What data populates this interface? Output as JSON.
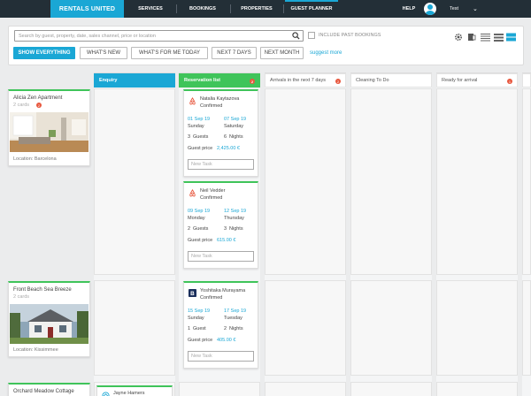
{
  "nav": {
    "brand": "RENTALS UNITED",
    "links": [
      "SERVICES",
      "BOOKINGS",
      "PROPERTIES",
      "GUEST PLANNER"
    ],
    "help": "HELP",
    "user": "Test",
    "active_color": "#1aa7d5"
  },
  "filters": {
    "search_placeholder": "Search by guest, property, date, sales channel, price or location",
    "include_past": "INCLUDE PAST BOOKINGS",
    "buttons": [
      "SHOW EVERYTHING",
      "WHAT'S NEW",
      "WHAT'S FOR ME TODAY",
      "NEXT 7 DAYS",
      "NEXT MONTH"
    ],
    "suggest_more": "suggest more",
    "icons": [
      "gear-icon",
      "export-icon",
      "list-view-icon",
      "compact-view-icon",
      "card-view-icon"
    ]
  },
  "columns": [
    {
      "title": "Enquiry",
      "badge": ""
    },
    {
      "title": "Reservation list",
      "badge": "2"
    },
    {
      "title": "Arrivals in the next 7 days",
      "badge": "2"
    },
    {
      "title": "Cleaning To Do",
      "badge": ""
    },
    {
      "title": "Ready for arrival",
      "badge": "1"
    }
  ],
  "properties": [
    {
      "name": "Alicia Zen Apartment",
      "cards": "2 cards",
      "badge": "2",
      "location_label": "Location:",
      "location": "Barcelona"
    },
    {
      "name": "Front Beach Sea Breeze",
      "cards": "2 cards",
      "badge": "",
      "location_label": "Location:",
      "location": "Kissimmee"
    },
    {
      "name": "Orchard Meadow Cottage",
      "cards": "",
      "badge": "",
      "location_label": "",
      "location": ""
    }
  ],
  "reservations": [
    {
      "guest": "Natalia Kaytazova",
      "status": "Confirmed",
      "channel": "airbnb-icon",
      "checkin_date": "01 Sep 19",
      "checkin_day": "Sunday",
      "checkout_date": "07 Sep 19",
      "checkout_day": "Saturday",
      "guests": "3",
      "guests_label": "Guests",
      "nights": "6",
      "nights_label": "Nights",
      "price_label": "Guest price",
      "price": "2,425.00 €",
      "task_placeholder": "New Task"
    },
    {
      "guest": "Neil Vedder",
      "status": "Confirmed",
      "channel": "airbnb-icon",
      "checkin_date": "09 Sep 19",
      "checkin_day": "Monday",
      "checkout_date": "12 Sep 19",
      "checkout_day": "Thursday",
      "guests": "2",
      "guests_label": "Guests",
      "nights": "3",
      "nights_label": "Nights",
      "price_label": "Guest price",
      "price": "615.00 €",
      "task_placeholder": "New Task"
    },
    {
      "guest": "Yoshitaka Murayama",
      "status": "Confirmed",
      "channel": "booking-icon",
      "checkin_date": "15 Sep 19",
      "checkin_day": "Sunday",
      "checkout_date": "17 Sep 19",
      "checkout_day": "Tuesday",
      "guests": "1",
      "guests_label": "Guest",
      "nights": "2",
      "nights_label": "Nights",
      "price_label": "Guest price",
      "price": "405.00 €",
      "task_placeholder": "New Task"
    },
    {
      "guest": "Jayne Hamers",
      "status": "",
      "channel": "other-icon"
    }
  ]
}
